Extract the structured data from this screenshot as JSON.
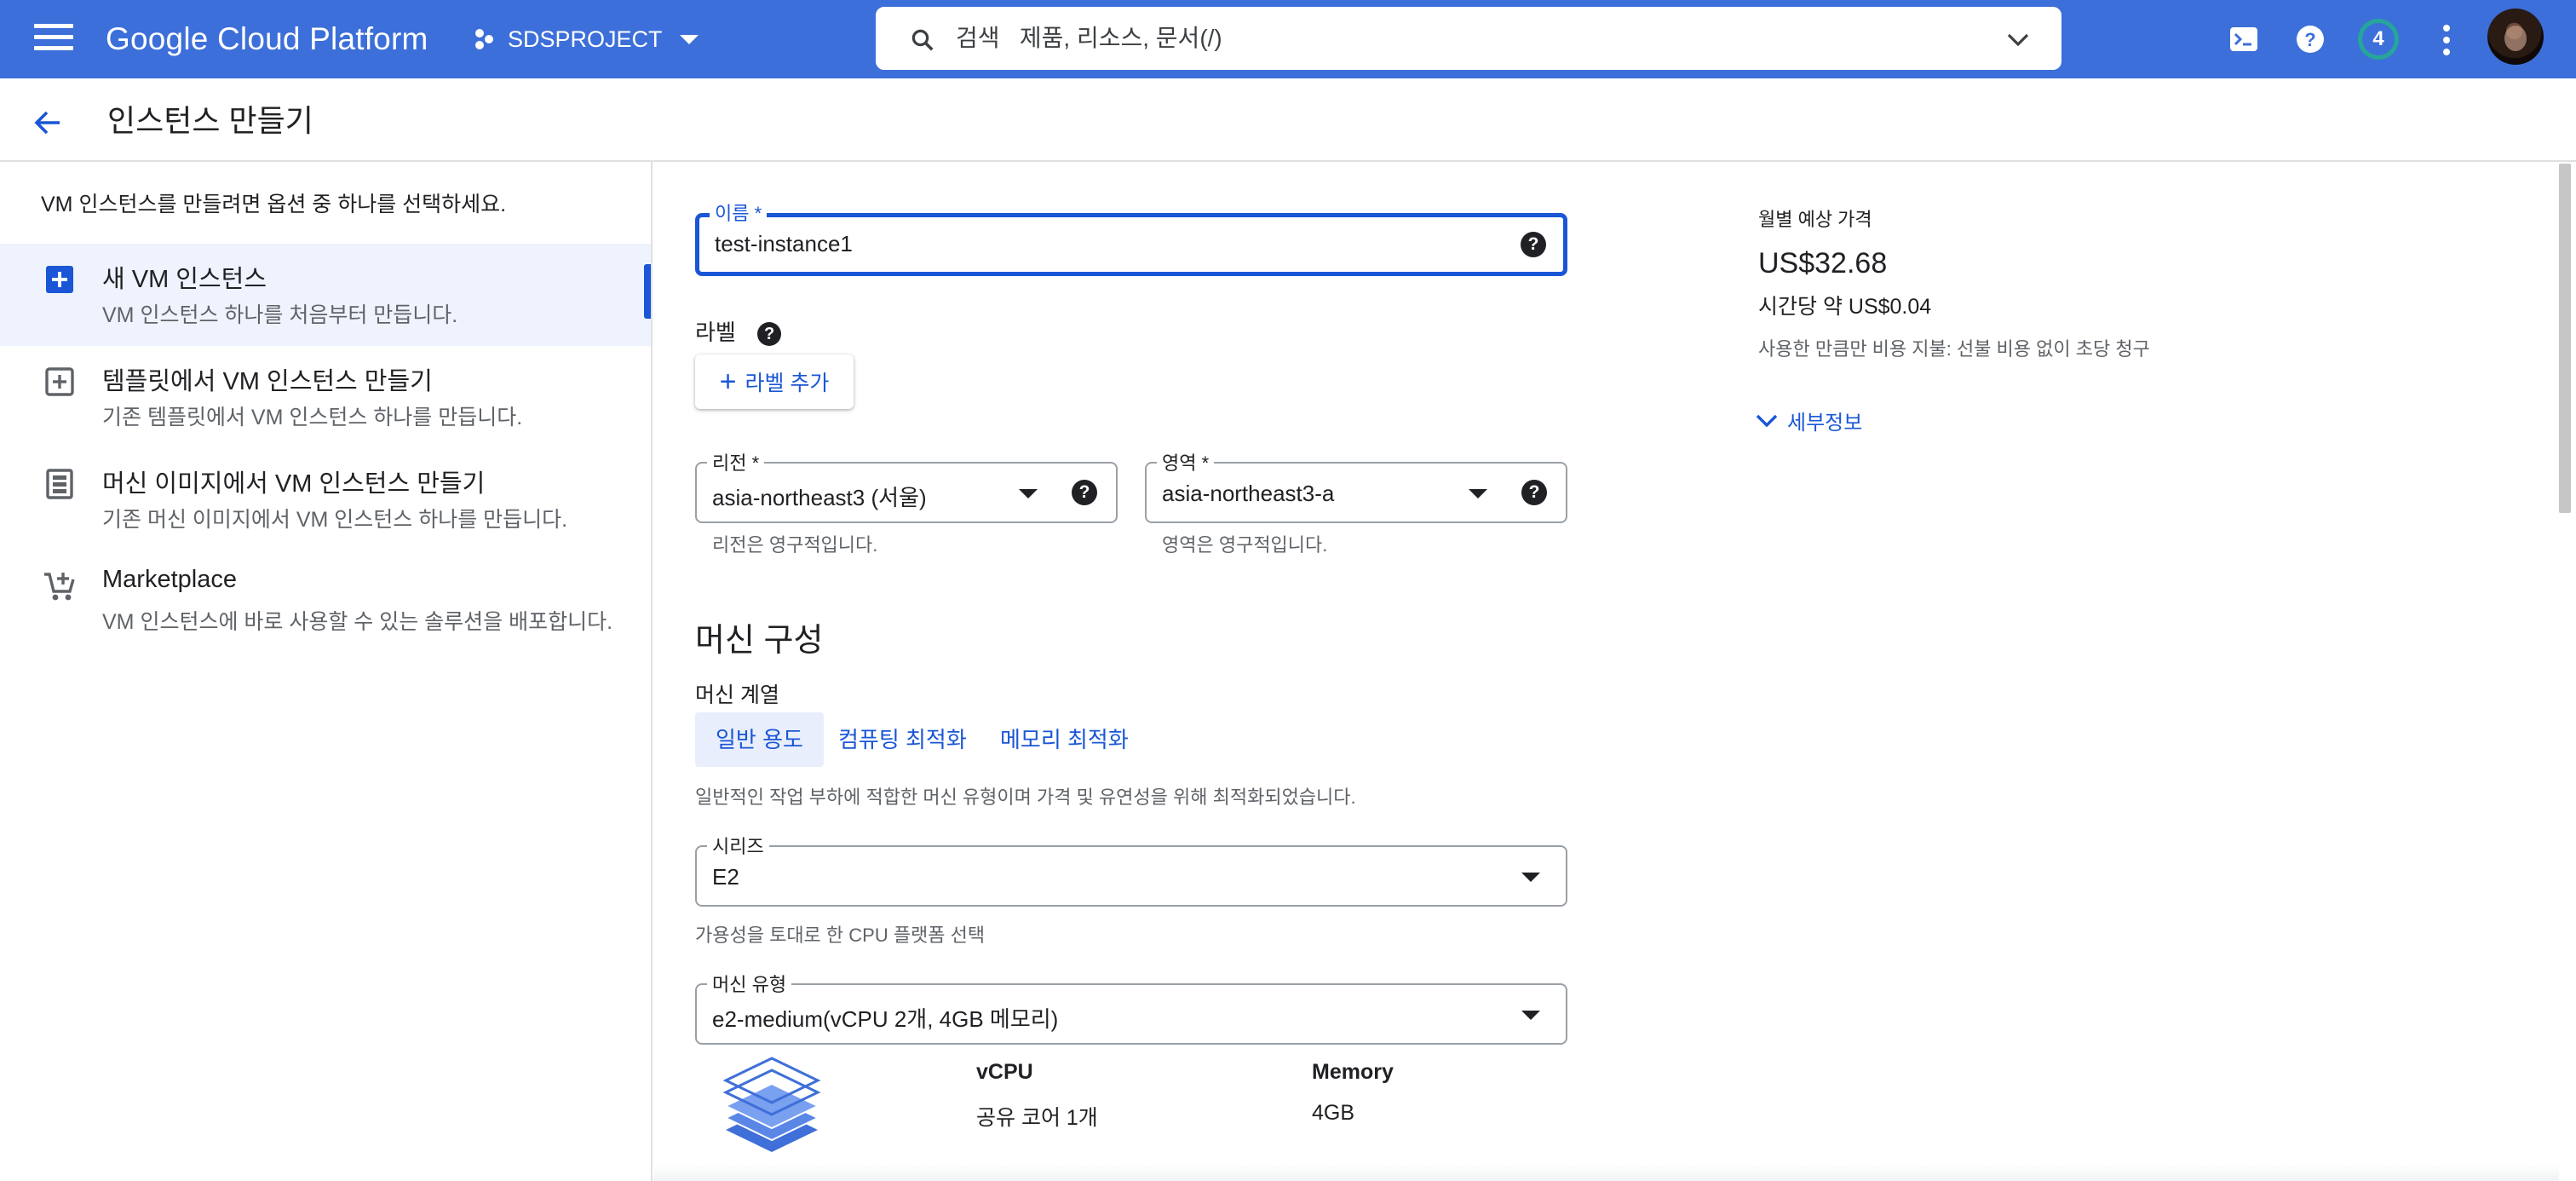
{
  "topbar": {
    "brand": "Google Cloud Platform",
    "project": "SDSPROJECT",
    "search_label": "검색",
    "search_placeholder": "제품, 리소스, 문서(/)",
    "notification_count": "4"
  },
  "page": {
    "title": "인스턴스 만들기"
  },
  "left_panel": {
    "intro": "VM 인스턴스를 만들려면 옵션 중 하나를 선택하세요.",
    "options": [
      {
        "title": "새 VM 인스턴스",
        "desc": "VM 인스턴스 하나를 처음부터 만듭니다.",
        "icon": "add-box-icon"
      },
      {
        "title": "템플릿에서 VM 인스턴스 만들기",
        "desc": "기존 템플릿에서 VM 인스턴스 하나를 만듭니다.",
        "icon": "add-box-outline-icon"
      },
      {
        "title": "머신 이미지에서 VM 인스턴스 만들기",
        "desc": "기존 머신 이미지에서 VM 인스턴스 하나를 만듭니다.",
        "icon": "machine-image-icon"
      },
      {
        "title": "Marketplace",
        "desc": "VM 인스턴스에 바로 사용할 수 있는 솔루션을 배포합니다.",
        "icon": "cart-add-icon"
      }
    ]
  },
  "form": {
    "name": {
      "label": "이름 *",
      "value": "test-instance1"
    },
    "labels": {
      "title": "라벨",
      "add_button": "라벨 추가"
    },
    "region": {
      "label": "리전 *",
      "value": "asia-northeast3 (서울)",
      "hint": "리전은 영구적입니다."
    },
    "zone": {
      "label": "영역 *",
      "value": "asia-northeast3-a",
      "hint": "영역은 영구적입니다."
    },
    "machine_config": {
      "title": "머신 구성",
      "family_label": "머신 계열",
      "tabs": [
        "일반 용도",
        "컴퓨팅 최적화",
        "메모리 최적화"
      ],
      "active_tab": 0,
      "family_desc": "일반적인 작업 부하에 적합한 머신 유형이며 가격 및 유연성을 위해 최적화되었습니다.",
      "series": {
        "label": "시리즈",
        "value": "E2",
        "hint": "가용성을 토대로 한 CPU 플랫폼 선택"
      },
      "machine_type": {
        "label": "머신 유형",
        "value": "e2-medium(vCPU 2개, 4GB 메모리)"
      },
      "specs": {
        "vcpu_header": "vCPU",
        "vcpu_value": "공유 코어 1개",
        "memory_header": "Memory",
        "memory_value": "4GB"
      }
    }
  },
  "pricing": {
    "label": "월별 예상 가격",
    "monthly": "US$32.68",
    "hourly": "시간당 약 US$0.04",
    "note": "사용한 만큼만 비용 지불: 선불 비용 없이 초당 청구",
    "details_link": "세부정보"
  },
  "colors": {
    "topbar": "#3c6fd9",
    "accent": "#1a56d6",
    "active_option_bg": "#eef3fd"
  }
}
